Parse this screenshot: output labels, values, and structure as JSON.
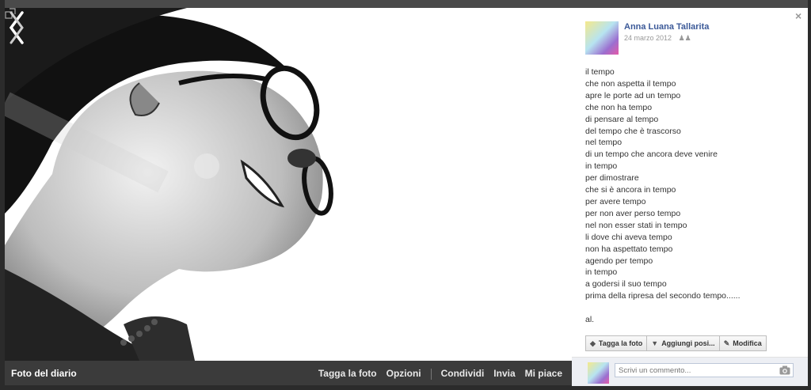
{
  "photo_bar": {
    "album_label": "Foto del diario",
    "actions": [
      "Tagga la foto",
      "Opzioni",
      "Condividi",
      "Invia",
      "Mi piace"
    ]
  },
  "post": {
    "author": "Anna Luana Tallarita",
    "date": "24 marzo 2012",
    "caption_lines": [
      "il tempo",
      "che non aspetta il tempo",
      "apre le porte ad un tempo",
      "che non ha tempo",
      "di pensare al tempo",
      "del tempo che è trascorso",
      "nel tempo",
      "di un tempo che ancora deve venire",
      "in tempo",
      "per dimostrare",
      "che si è ancora in tempo",
      "per avere tempo",
      "per non aver perso tempo",
      "nel non esser stati in tempo",
      "li dove chi aveva tempo",
      "non ha aspettato tempo",
      "agendo per tempo",
      "in tempo",
      "a godersi il suo tempo",
      "prima della ripresa del secondo tempo......",
      "",
      "al."
    ]
  },
  "buttons": {
    "tag": "Tagga la foto",
    "place": "Aggiungi posi...",
    "edit": "Modifica"
  },
  "comment": {
    "placeholder": "Scrivi un commento..."
  },
  "colors": {
    "link": "#3b5998",
    "bar": "#3b3b3b"
  }
}
